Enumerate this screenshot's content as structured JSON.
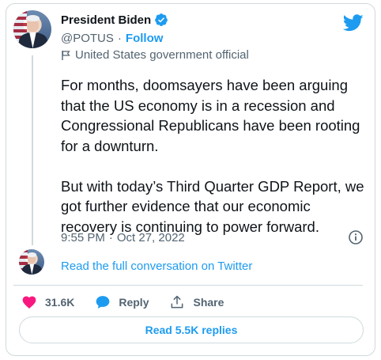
{
  "author": {
    "display_name": "President Biden",
    "handle": "@POTUS",
    "follow_label": "Follow",
    "label": "United States government official",
    "separator": "·"
  },
  "tweet": {
    "text": "For months, doomsayers have been arguing that the US economy is in a recession and Congressional Republicans have been rooting for a downturn.\n\nBut with today’s Third Quarter GDP Report, we got further evidence that our economic recovery is continuing to power forward.",
    "time": "9:55 PM",
    "date": "Oct 27, 2022",
    "separator": "·"
  },
  "conversation": {
    "read_full_label": "Read the full conversation on Twitter"
  },
  "actions": {
    "likes": "31.6K",
    "reply_label": "Reply",
    "share_label": "Share"
  },
  "replies_button": {
    "label": "Read 5.5K replies"
  },
  "colors": {
    "accent": "#1d9bf0",
    "like": "#f91880",
    "muted": "#536471",
    "border": "#cfd9de"
  },
  "icons": {
    "verified": "verified-badge-icon",
    "label": "flag-icon",
    "logo": "twitter-bird-icon",
    "info": "info-icon",
    "like": "heart-icon",
    "reply": "speech-bubble-icon",
    "share": "share-upload-icon"
  }
}
